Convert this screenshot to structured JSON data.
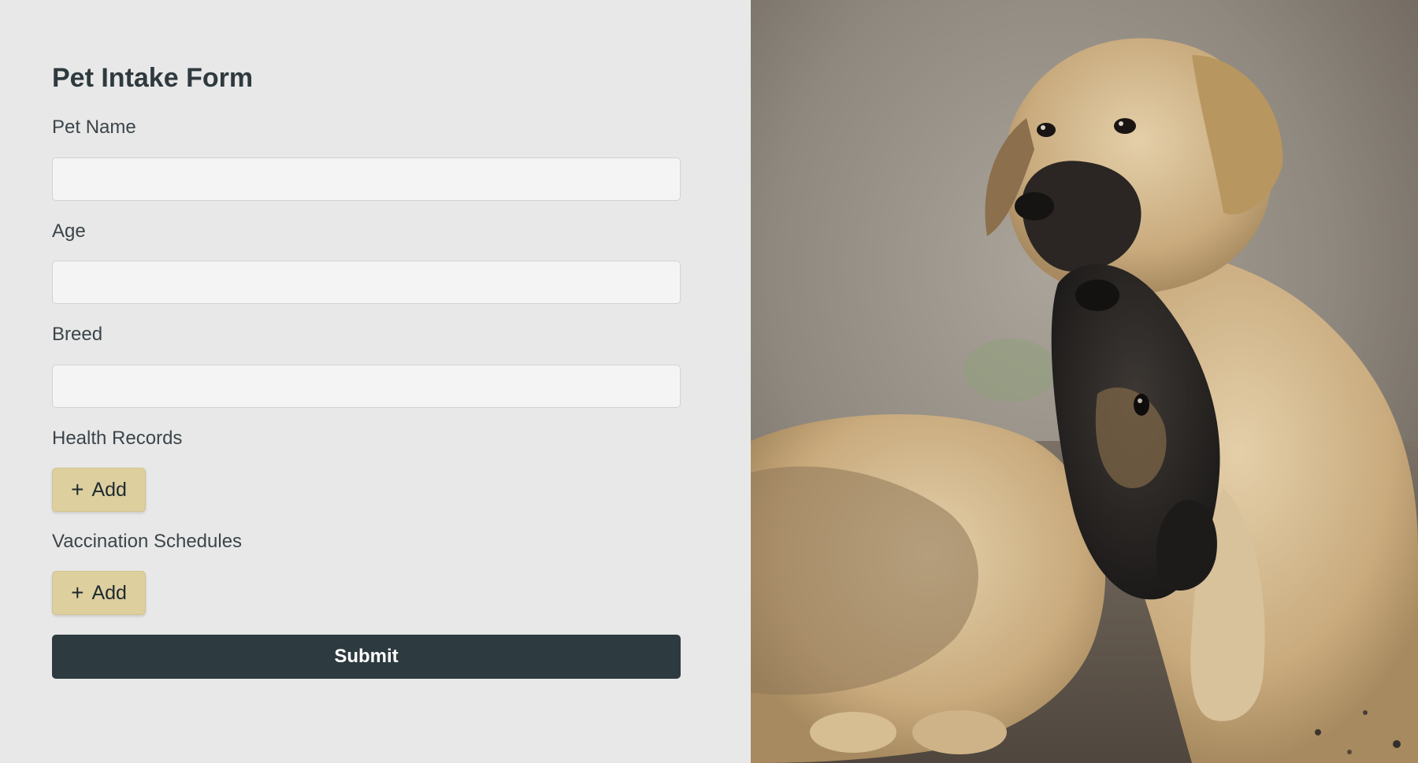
{
  "form": {
    "title": "Pet Intake Form",
    "fields": [
      {
        "label": "Pet Name",
        "value": "",
        "placeholder": ""
      },
      {
        "label": "Age",
        "value": "",
        "placeholder": ""
      },
      {
        "label": "Breed",
        "value": "",
        "placeholder": ""
      }
    ],
    "health_records": {
      "label": "Health Records",
      "add_label": "Add",
      "add_icon": "plus-icon"
    },
    "vaccination_schedules": {
      "label": "Vaccination Schedules",
      "add_label": "Add",
      "add_icon": "plus-icon"
    },
    "submit_label": "Submit"
  },
  "photo": {
    "subject": "two puppies playing"
  },
  "colors": {
    "panel_background": "#e8e8e8",
    "input_background": "#f4f4f4",
    "add_button": "#ddcf9e",
    "submit_button": "#2d3a40",
    "text": "#2f3a3f"
  }
}
